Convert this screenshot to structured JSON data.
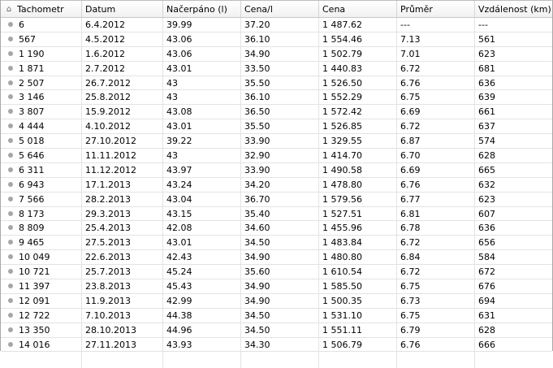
{
  "table": {
    "columns": [
      "Tachometr",
      "Datum",
      "Načerpáno (l)",
      "Cena/l",
      "Cena",
      "Průměr",
      "Vzdálenost (km)"
    ],
    "header_icon": "home-icon",
    "row_icon": "bullet-icon",
    "rows": [
      [
        "6",
        "6.4.2012",
        "39.99",
        "37.20",
        "1 487.62",
        "---",
        "---"
      ],
      [
        "567",
        "4.5.2012",
        "43.06",
        "36.10",
        "1 554.46",
        "7.13",
        "561"
      ],
      [
        "1 190",
        "1.6.2012",
        "43.06",
        "34.90",
        "1 502.79",
        "7.01",
        "623"
      ],
      [
        "1 871",
        "2.7.2012",
        "43.01",
        "33.50",
        "1 440.83",
        "6.72",
        "681"
      ],
      [
        "2 507",
        "26.7.2012",
        "43",
        "35.50",
        "1 526.50",
        "6.76",
        "636"
      ],
      [
        "3 146",
        "25.8.2012",
        "43",
        "36.10",
        "1 552.29",
        "6.75",
        "639"
      ],
      [
        "3 807",
        "15.9.2012",
        "43.08",
        "36.50",
        "1 572.42",
        "6.69",
        "661"
      ],
      [
        "4 444",
        "4.10.2012",
        "43.01",
        "35.50",
        "1 526.85",
        "6.72",
        "637"
      ],
      [
        "5 018",
        "27.10.2012",
        "39.22",
        "33.90",
        "1 329.55",
        "6.87",
        "574"
      ],
      [
        "5 646",
        "11.11.2012",
        "43",
        "32.90",
        "1 414.70",
        "6.70",
        "628"
      ],
      [
        "6 311",
        "11.12.2012",
        "43.97",
        "33.90",
        "1 490.58",
        "6.69",
        "665"
      ],
      [
        "6 943",
        "17.1.2013",
        "43.24",
        "34.20",
        "1 478.80",
        "6.76",
        "632"
      ],
      [
        "7 566",
        "28.2.2013",
        "43.04",
        "36.70",
        "1 579.56",
        "6.77",
        "623"
      ],
      [
        "8 173",
        "29.3.2013",
        "43.15",
        "35.40",
        "1 527.51",
        "6.81",
        "607"
      ],
      [
        "8 809",
        "25.4.2013",
        "42.08",
        "34.60",
        "1 455.96",
        "6.78",
        "636"
      ],
      [
        "9 465",
        "27.5.2013",
        "43.01",
        "34.50",
        "1 483.84",
        "6.72",
        "656"
      ],
      [
        "10 049",
        "22.6.2013",
        "42.43",
        "34.90",
        "1 480.80",
        "6.84",
        "584"
      ],
      [
        "10 721",
        "25.7.2013",
        "45.24",
        "35.60",
        "1 610.54",
        "6.72",
        "672"
      ],
      [
        "11 397",
        "23.8.2013",
        "45.43",
        "34.90",
        "1 585.50",
        "6.75",
        "676"
      ],
      [
        "12 091",
        "11.9.2013",
        "42.99",
        "34.90",
        "1 500.35",
        "6.73",
        "694"
      ],
      [
        "12 722",
        "7.10.2013",
        "44.38",
        "34.50",
        "1 531.10",
        "6.75",
        "631"
      ],
      [
        "13 350",
        "28.10.2013",
        "44.96",
        "34.50",
        "1 551.11",
        "6.79",
        "628"
      ],
      [
        "14 016",
        "27.11.2013",
        "43.93",
        "34.30",
        "1 506.79",
        "6.76",
        "666"
      ]
    ]
  }
}
